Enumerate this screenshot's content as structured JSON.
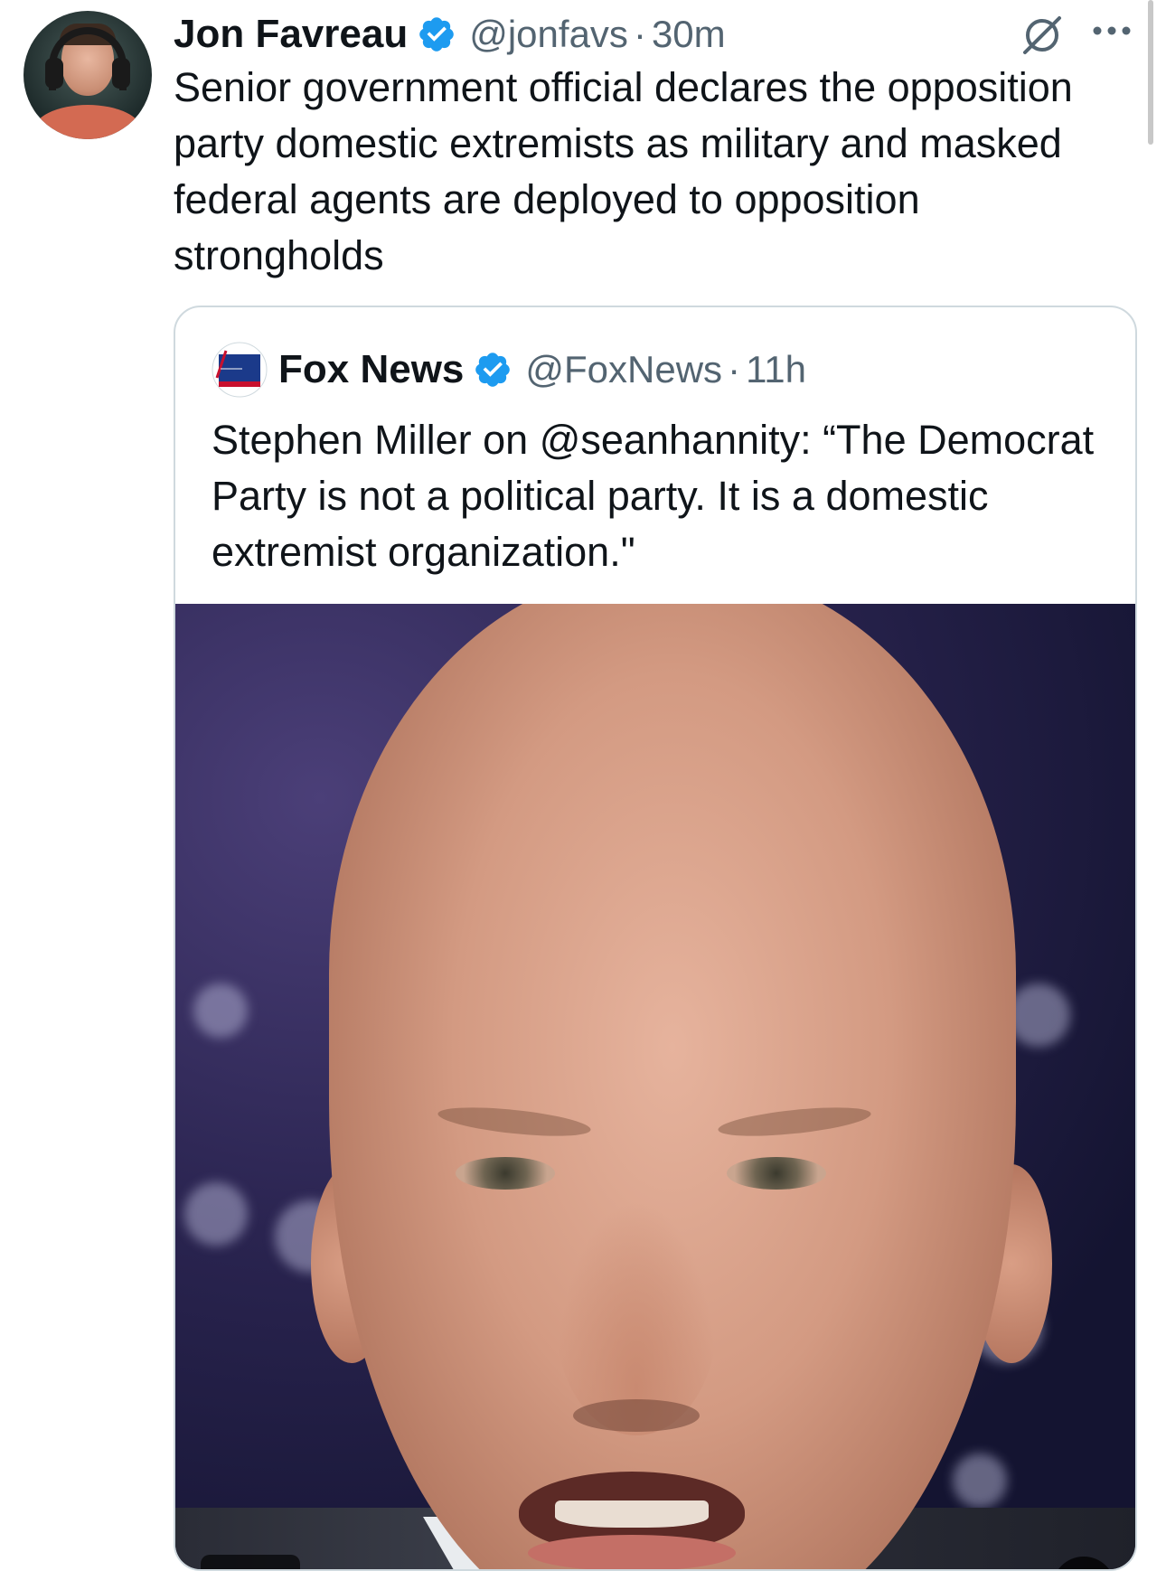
{
  "tweet": {
    "author": {
      "name": "Jon Favreau",
      "handle": "@jonfavs",
      "separator": "·",
      "time": "30m",
      "avatar_icon": "profile-photo"
    },
    "text": "Senior government official declares the opposition party domestic extremists as military and masked federal agents are deployed to opposition strongholds",
    "icons": {
      "grok": "grok-icon",
      "more": "more-icon",
      "verified": "verified-badge-icon"
    },
    "colors": {
      "verified_blue": "#1d9bf0",
      "secondary_text": "#536471",
      "border": "#cfd9de"
    }
  },
  "quoted": {
    "author": {
      "name": "Fox News",
      "handle": "@FoxNews",
      "separator": "·",
      "time": "11h",
      "avatar_icon": "fox-news-logo"
    },
    "text": "Stephen Miller on @seanhannity: “The Democrat Party is not a political party. It is a domestic extremist organization.\"",
    "media": {
      "type": "video",
      "subject": "man-speaking-closeup"
    }
  }
}
